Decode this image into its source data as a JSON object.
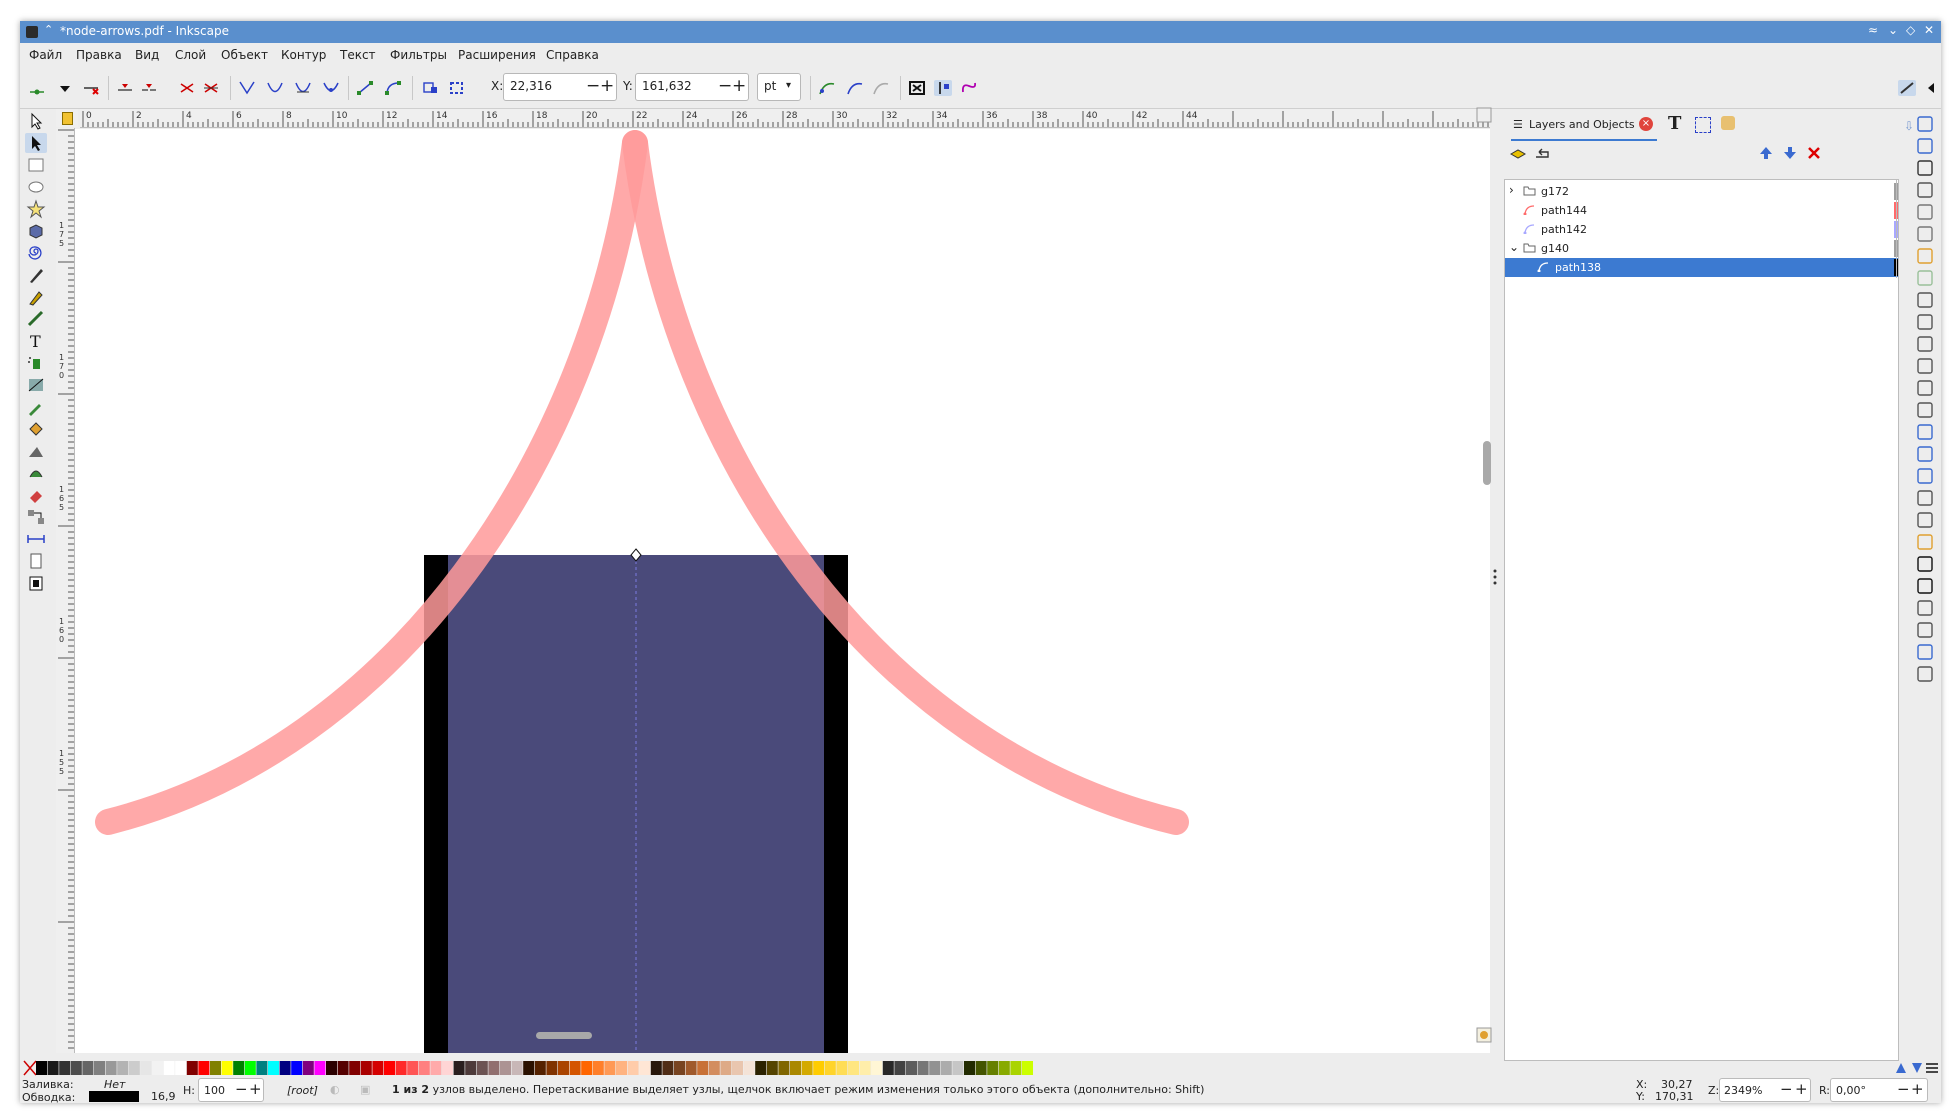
{
  "window": {
    "title": "*node-arrows.pdf - Inkscape",
    "controls": [
      "≈",
      "⌄",
      "◇",
      "✕"
    ]
  },
  "menu": [
    "Файл",
    "Правка",
    "Вид",
    "Слой",
    "Объект",
    "Контур",
    "Текст",
    "Фильтры",
    "Расширения",
    "Справка"
  ],
  "toolbar": {
    "x_label": "X:",
    "x_value": "22,316",
    "y_label": "Y:",
    "y_value": "161,632",
    "unit": "pt"
  },
  "ruler": {
    "h_ticks": [
      "0",
      "2",
      "4",
      "6",
      "8",
      "10",
      "12",
      "14",
      "16",
      "18",
      "20",
      "22",
      "24",
      "26",
      "28",
      "30",
      "32",
      "34",
      "36",
      "38",
      "40",
      "42",
      "44"
    ],
    "v_ticks": [
      "175",
      "170",
      "165",
      "160",
      "155"
    ]
  },
  "panel": {
    "tab_label": "Layers and Objects",
    "items": [
      {
        "name": "g172",
        "type": "group",
        "expander": "closed",
        "color": "#9f9f9f"
      },
      {
        "name": "path144",
        "type": "path",
        "expander": "",
        "color": "#ff6b6b"
      },
      {
        "name": "path142",
        "type": "path",
        "expander": "",
        "color": "#a8a8ff"
      },
      {
        "name": "g140",
        "type": "group",
        "expander": "open",
        "color": "#9f9f9f"
      },
      {
        "name": "path138",
        "type": "path",
        "expander": "",
        "color": "#000000",
        "selected": true
      }
    ]
  },
  "status": {
    "fill_label": "Заливка:",
    "fill_value": "Нет",
    "stroke_label": "Обводка:",
    "stroke_width": "16,9",
    "opacity_label": "Н:",
    "opacity_value": "100",
    "layer": "[root]",
    "message_bold": "1 из 2",
    "message": " узлов выделено. Перетаскивание выделяет узлы, щелчок включает режим изменения только этого объекта (дополнительно: Shift)",
    "x_label": "X:",
    "x_value": "30,27",
    "y_label": "Y:",
    "y_value": "170,31",
    "zoom_label": "Z:",
    "zoom_value": "2349%",
    "rot_label": "R:",
    "rot_value": "0,00°"
  },
  "colors": {
    "titlebar": "#5a8fcd",
    "selection": "#3c7ad1",
    "pink_stroke": "#ff9a9a",
    "rect_fill": "#4a4a7a",
    "rect_stroke": "#000000"
  }
}
